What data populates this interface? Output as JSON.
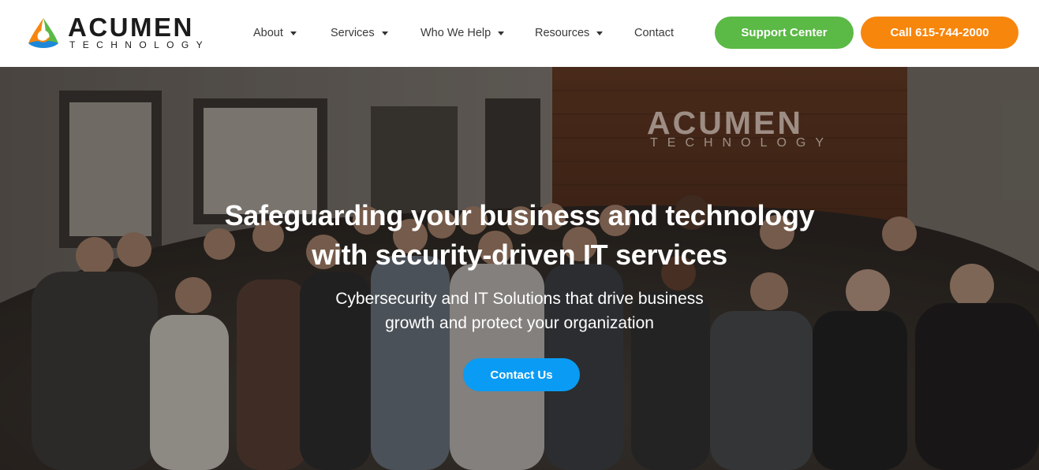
{
  "brand": {
    "name": "ACUMEN",
    "tagline": "TECHNOLOGY",
    "colors": {
      "orange": "#f7860d",
      "green": "#5bb946",
      "blue": "#0a9cf4",
      "dark": "#1b1b1b"
    }
  },
  "nav": {
    "items": [
      {
        "label": "About",
        "dropdown": true
      },
      {
        "label": "Services",
        "dropdown": true
      },
      {
        "label": "Who We Help",
        "dropdown": true
      },
      {
        "label": "Resources",
        "dropdown": true
      },
      {
        "label": "Contact",
        "dropdown": false
      }
    ],
    "support_label": "Support Center",
    "call_label": "Call 615-744-2000"
  },
  "hero": {
    "headline_line1": "Safeguarding your business and technology",
    "headline_line2": "with security-driven IT services",
    "sub_line1": "Cybersecurity and IT Solutions that drive business",
    "sub_line2": "growth and protect your organization",
    "cta_label": "Contact Us",
    "wall_sign": {
      "name": "ACUMEN",
      "tagline": "TECHNOLOGY"
    }
  },
  "icons": {
    "logo": "acumen-tri-ring-logo-icon",
    "caret": "chevron-down-icon"
  }
}
